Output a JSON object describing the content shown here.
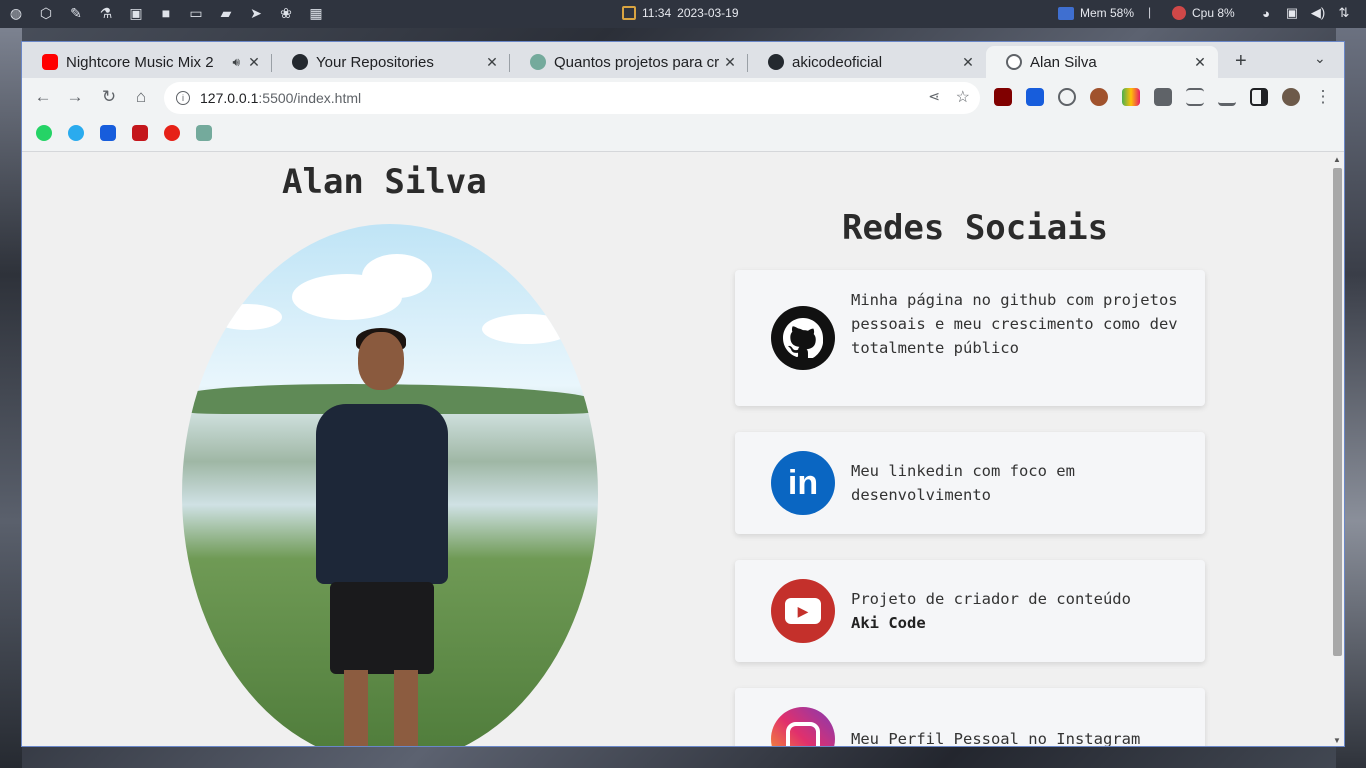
{
  "panel": {
    "launchers": [
      "globe-icon",
      "codepen-icon",
      "dropper-icon",
      "flask-icon",
      "image-icon",
      "video-icon",
      "laptop-icon",
      "folder-icon",
      "telegram-icon",
      "paw-icon",
      "grid-icon"
    ],
    "clock_time": "11:34",
    "clock_date": "2023-03-19",
    "mem_label": "Mem 58%",
    "separator": "|",
    "cpu_label": "Cpu  8%"
  },
  "browser": {
    "tabs": [
      {
        "title": "Nightcore Music Mix 2",
        "favicon": "youtube-icon",
        "color": "#ff0000"
      },
      {
        "title": "Your Repositories",
        "favicon": "github-icon",
        "color": "#24292f"
      },
      {
        "title": "Quantos projetos para cr",
        "favicon": "chatgpt-icon",
        "color": "#74aa9c"
      },
      {
        "title": "akicodeoficial",
        "favicon": "github-icon",
        "color": "#24292f"
      },
      {
        "title": "Alan Silva",
        "favicon": "globe-icon",
        "color": "#5f6368"
      }
    ],
    "new_tab_label": "+",
    "url_host": "127.0.0.1",
    "url_path": ":5500/index.html"
  },
  "page": {
    "name": "Alan Silva",
    "section_title": "Redes Sociais",
    "cards": [
      {
        "network": "github",
        "text": "Minha página no github com projetos pessoais e meu crescimento como dev totalmente público",
        "strong": "",
        "color": "#111111",
        "glyph": ""
      },
      {
        "network": "linkedin",
        "text": "Meu linkedin com foco em desenvolvimento",
        "strong": "",
        "color": "#0a66c2",
        "glyph": "in"
      },
      {
        "network": "youtube",
        "text": "Projeto de criador de conteúdo",
        "strong": "Aki Code",
        "color": "#c4302b",
        "glyph": "▶"
      },
      {
        "network": "instagram",
        "text": "Meu Perfil Pessoal no Instagram",
        "strong": "",
        "color": "#c13584",
        "glyph": ""
      }
    ]
  }
}
